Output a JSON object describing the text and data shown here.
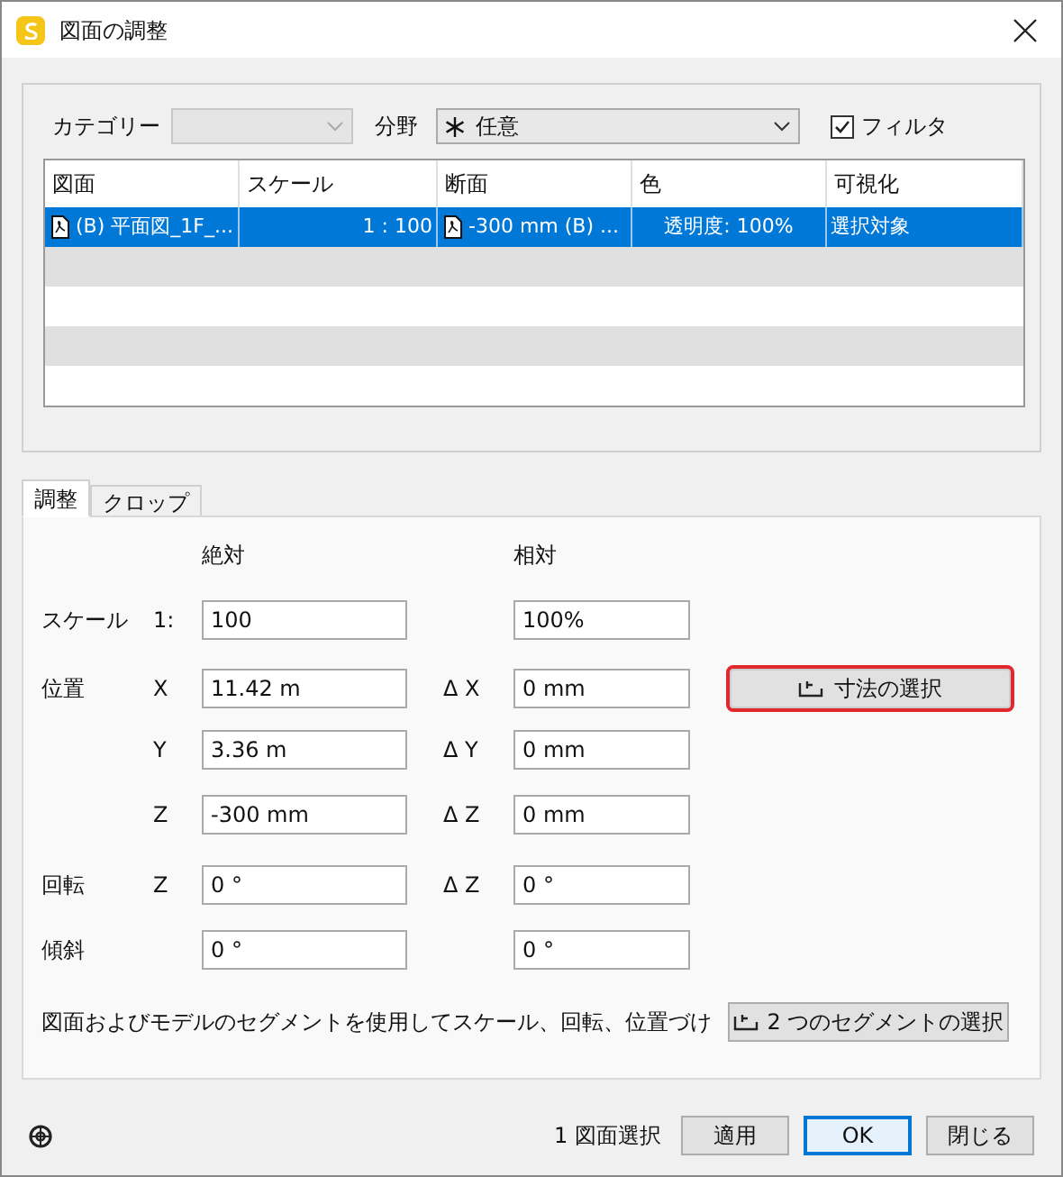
{
  "window": {
    "title": "図面の調整"
  },
  "filters": {
    "category": {
      "label": "カテゴリー",
      "disabled": true
    },
    "discipline": {
      "label": "分野",
      "value": "任意"
    },
    "filter_checkbox": {
      "label": "フィルタ",
      "checked": true
    }
  },
  "table": {
    "columns": [
      "図面",
      "スケール",
      "断面",
      "色",
      "可視化"
    ],
    "rows": [
      {
        "selected": true,
        "cells": [
          {
            "text": "(B) 平面図_1F_...",
            "file_icon": true
          },
          {
            "text": "1 : 100"
          },
          {
            "text": "-300 mm (B) ...",
            "file_icon": true
          },
          {
            "text": "透明度: 100%"
          },
          {
            "text": "選択対象"
          }
        ]
      }
    ]
  },
  "tabs": [
    {
      "label": "調整",
      "selected": true
    },
    {
      "label": "クロップ",
      "selected": false
    }
  ],
  "form": {
    "headings": [
      "絶対",
      "相対"
    ],
    "rows": [
      {
        "label": "スケール",
        "axis": "1:",
        "absolute": "100",
        "relative": "100%"
      },
      {
        "label": "位置",
        "axis": "X",
        "absolute": "11.42 m",
        "delta_label": "Δ X",
        "relative": "0 mm",
        "button": {
          "label": "寸法の選択",
          "highlighted": true
        }
      },
      {
        "axis": "Y",
        "absolute": "3.36 m",
        "delta_label": "Δ Y",
        "relative": "0 mm"
      },
      {
        "axis": "Z",
        "absolute": "-300 mm",
        "delta_label": "Δ Z",
        "relative": "0 mm"
      },
      {
        "label": "回転",
        "axis": "Z",
        "absolute": "0 °",
        "delta_label": "Δ Z",
        "relative": "0 °"
      },
      {
        "label": "傾斜",
        "absolute": "0 °",
        "relative": "0 °"
      }
    ],
    "description": "図面およびモデルのセグメントを使用してスケール、回転、位置づけ",
    "segments_button": "2 つのセグメントの選択"
  },
  "footer": {
    "status": "1 図面選択",
    "buttons": [
      {
        "label": "適用",
        "focused": false
      },
      {
        "label": "OK",
        "focused": true
      },
      {
        "label": "閉じる",
        "focused": false
      }
    ]
  }
}
